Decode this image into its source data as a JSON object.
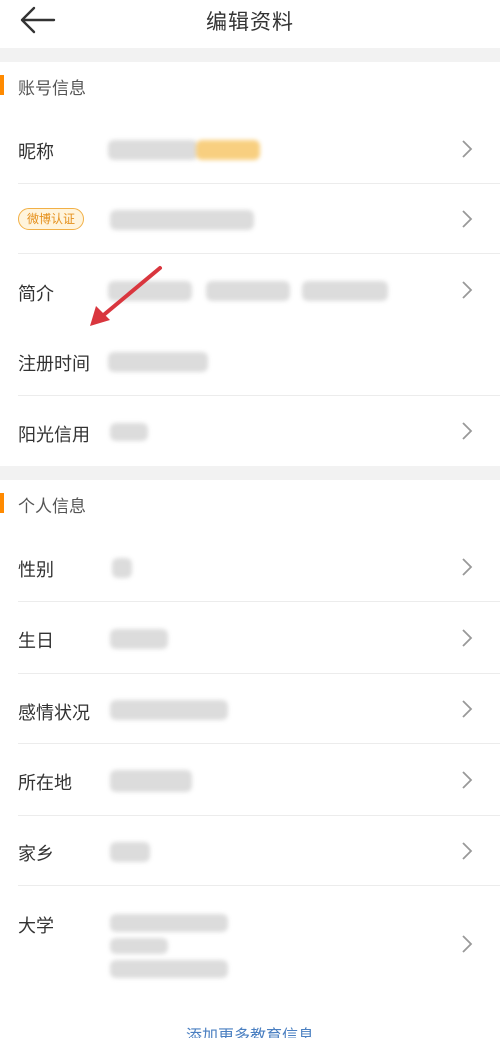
{
  "header": {
    "title": "编辑资料"
  },
  "sections": {
    "account": {
      "title": "账号信息",
      "rows": {
        "nickname": "昵称",
        "verify_badge": "微博认证",
        "intro": "简介",
        "register_time": "注册时间",
        "credit": "阳光信用"
      }
    },
    "personal": {
      "title": "个人信息",
      "rows": {
        "gender": "性别",
        "birthday": "生日",
        "relationship": "感情状况",
        "location": "所在地",
        "hometown": "家乡",
        "university": "大学"
      }
    }
  },
  "footer": {
    "add_education": "添加更多教育信息"
  },
  "colors": {
    "accent": "#ff8a00",
    "badge_text": "#e5901c",
    "link": "#4a7fc1",
    "annotation_arrow": "#d9363e"
  },
  "icons": {
    "back": "back-arrow-icon",
    "chevron": "chevron-right-icon"
  }
}
